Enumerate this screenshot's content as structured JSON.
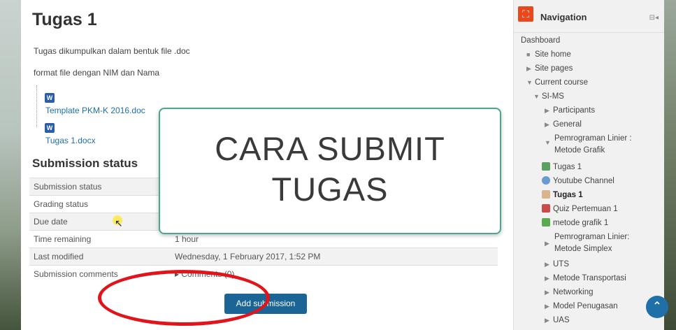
{
  "main": {
    "title": "Tugas 1",
    "intro1": "Tugas dikumpulkan dalam bentuk file .doc",
    "intro2": "format file dengan NIM dan Nama",
    "files": [
      {
        "name": "Template PKM-K 2016.doc",
        "icon": "W"
      },
      {
        "name": "Tugas 1.docx",
        "icon": "W"
      }
    ],
    "submission_heading": "Submission status",
    "status_rows": [
      {
        "label": "Submission status",
        "value": ""
      },
      {
        "label": "Grading status",
        "value": ""
      },
      {
        "label": "Due date",
        "value": ""
      },
      {
        "label": "Time remaining",
        "value": "1 hour"
      },
      {
        "label": "Last modified",
        "value": "Wednesday, 1 February 2017, 1:52 PM"
      },
      {
        "label": "Submission comments",
        "value": "▸ Comments (0)"
      }
    ],
    "add_submission_label": "Add submission"
  },
  "overlay": {
    "line1": "CARA SUBMIT",
    "line2": "TUGAS"
  },
  "nav": {
    "title": "Navigation",
    "controls": "⊟◂",
    "items": [
      {
        "label": "Dashboard"
      },
      {
        "label": "Site home"
      },
      {
        "label": "Site pages"
      },
      {
        "label": "Current course"
      },
      {
        "label": "SI-MS"
      },
      {
        "label": "Participants"
      },
      {
        "label": "General"
      },
      {
        "label": "Pemrograman Linier :"
      },
      {
        "label": "Metode Grafik"
      },
      {
        "label": "Tugas 1"
      },
      {
        "label": "Youtube Channel"
      },
      {
        "label": "Tugas 1"
      },
      {
        "label": "Quiz Pertemuan 1"
      },
      {
        "label": "metode grafik 1"
      },
      {
        "label": "Pemrograman Linier:"
      },
      {
        "label": "Metode Simplex"
      },
      {
        "label": "UTS"
      },
      {
        "label": "Metode Transportasi"
      },
      {
        "label": "Networking"
      },
      {
        "label": "Model Penugasan"
      },
      {
        "label": "UAS"
      }
    ]
  },
  "colors": {
    "accent": "#1a6496",
    "nav_logo": "#e8481c",
    "overlay_border": "#4aa890",
    "annotation": "#e0141a"
  }
}
